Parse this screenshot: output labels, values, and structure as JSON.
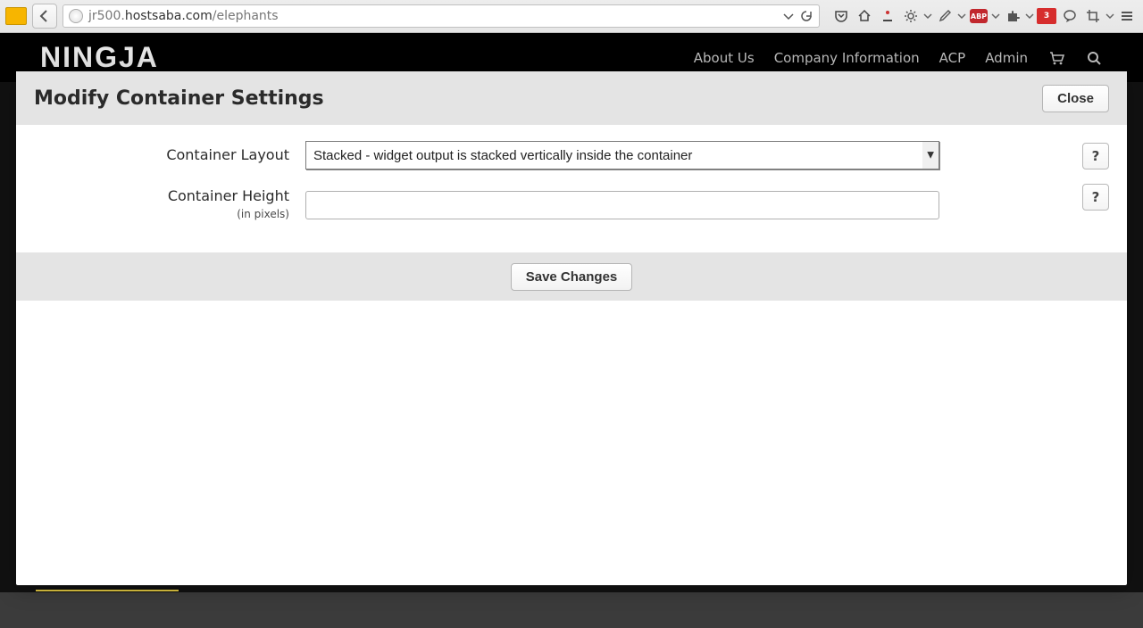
{
  "browser": {
    "url_prefix": "jr500.",
    "url_domain": "hostsaba.com",
    "url_path": "/elephants",
    "abp_label": "ABP",
    "badge_count": "3"
  },
  "page": {
    "brand": "NINGJA",
    "nav": {
      "about": "About Us",
      "company": "Company Information",
      "acp": "ACP",
      "admin": "Admin"
    }
  },
  "modal": {
    "title": "Modify Container Settings",
    "close_label": "Close",
    "layout_label": "Container Layout",
    "layout_selected": "Stacked - widget output is stacked vertically inside the container",
    "height_label": "Container Height",
    "height_sub": "(in pixels)",
    "height_value": "",
    "help_label": "?",
    "save_label": "Save Changes"
  }
}
